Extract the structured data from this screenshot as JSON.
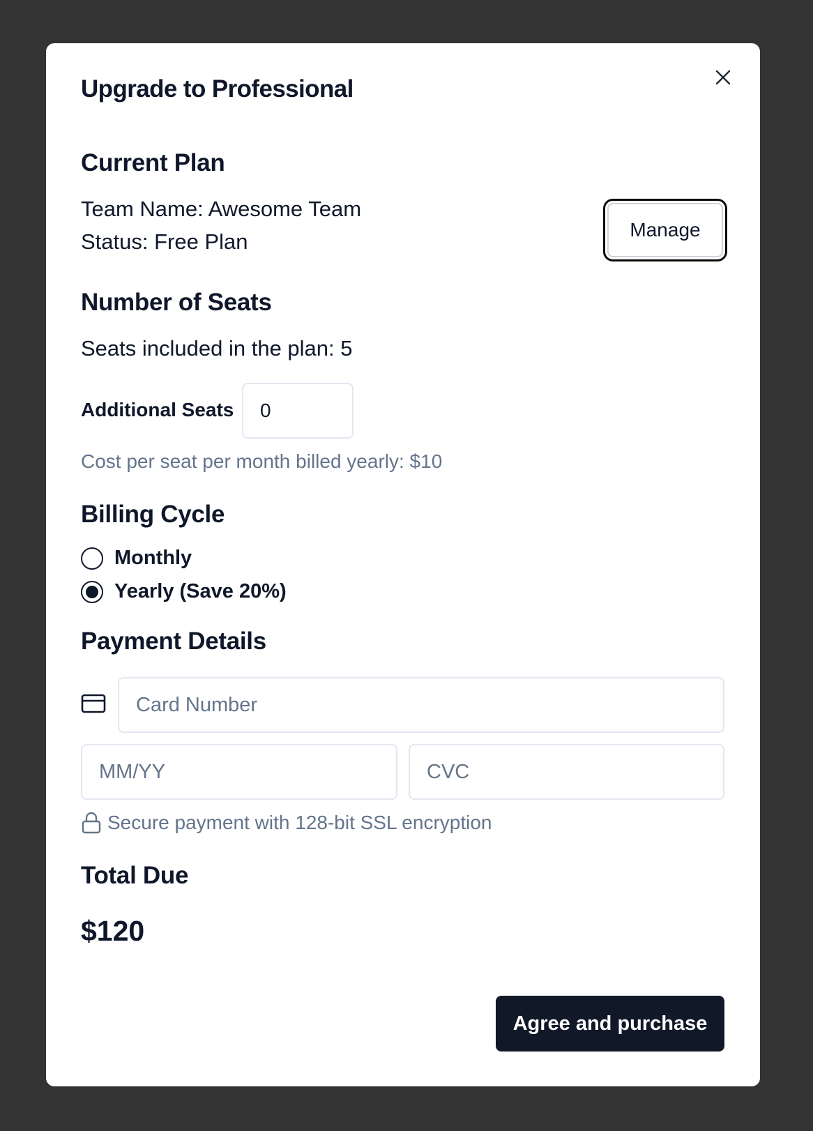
{
  "modal": {
    "title": "Upgrade to Professional"
  },
  "current_plan": {
    "heading": "Current Plan",
    "team_name": "Team Name: Awesome Team",
    "status": "Status: Free Plan",
    "manage_label": "Manage"
  },
  "seats": {
    "heading": "Number of Seats",
    "included": "Seats included in the plan: 5",
    "additional_label": "Additional Seats",
    "additional_value": "0",
    "cost_note": "Cost per seat per month billed yearly: $10"
  },
  "billing": {
    "heading": "Billing Cycle",
    "options": [
      {
        "label": "Monthly",
        "selected": false
      },
      {
        "label": "Yearly (Save 20%)",
        "selected": true
      }
    ]
  },
  "payment": {
    "heading": "Payment Details",
    "card_placeholder": "Card Number",
    "expiry_placeholder": "MM/YY",
    "cvc_placeholder": "CVC",
    "secure_note": "Secure payment with 128-bit SSL encryption",
    "card_icon": "credit-card-icon",
    "lock_icon": "lock-icon"
  },
  "total": {
    "heading": "Total Due",
    "amount": "$120"
  },
  "actions": {
    "purchase_label": "Agree and purchase"
  },
  "colors": {
    "backdrop": "#333333",
    "primary": "#111827",
    "muted_text": "#64748b",
    "border": "#e2e8f0"
  }
}
